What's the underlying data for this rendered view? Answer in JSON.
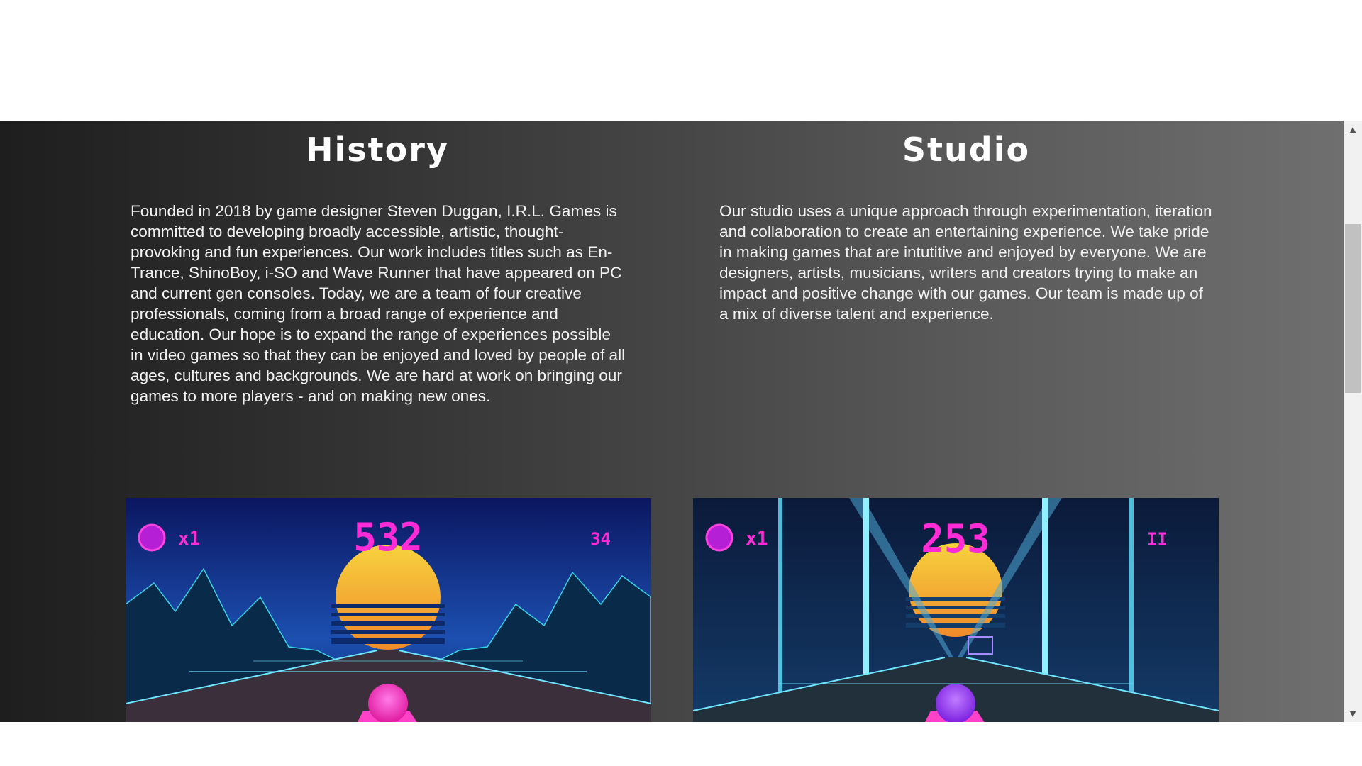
{
  "sections": [
    {
      "title": "History",
      "body": "Founded in 2018 by game designer Steven Duggan, I.R.L. Games is committed to developing broadly accessible, artistic, thought-provoking and fun experiences. Our work includes titles such as En-Trance, ShinoBoy, i-SO and Wave Runner that have appeared on PC and current gen consoles. Today, we are a team of four creative professionals, coming from a broad range of experience and education. Our hope is to expand the range of experiences possible in video games so that they can be enjoyed and loved by people of all ages, cultures and backgrounds. We are hard at work on bringing our games to more players - and on making new ones."
    },
    {
      "title": "Studio",
      "body": "Our studio uses a unique approach through experimentation, iteration and collaboration to create an entertaining experience. We take pride in making games that are intutitive and enjoyed by everyone. We are designers, artists, musicians, writers and creators trying to make an impact and positive change with our games. Our team is made up of a mix of diverse talent and experience."
    }
  ],
  "screenshots": [
    {
      "multiplier": "x1",
      "score": "532",
      "counter": "34",
      "icon": "pink-ball-icon"
    },
    {
      "multiplier": "x1",
      "score": "253",
      "counter": "II",
      "icon": "purple-ball-icon"
    }
  ],
  "colors": {
    "hud_magenta": "#ff2bd6",
    "sun_yellow": "#f5c533",
    "neon_cyan": "#5fe3ff"
  },
  "scrollbar": {
    "up_icon": "chevron-up-icon",
    "down_icon": "chevron-down-icon"
  }
}
